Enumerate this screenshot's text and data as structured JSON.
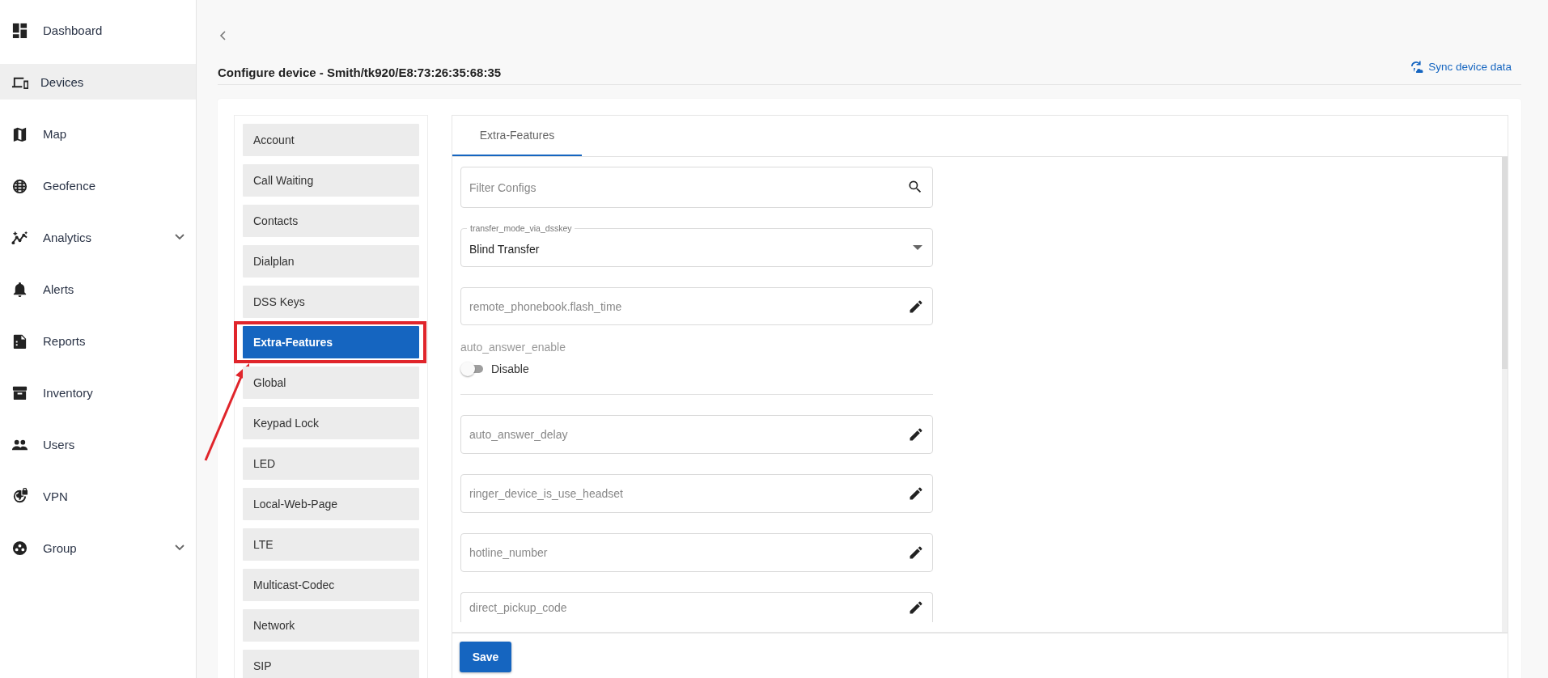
{
  "sidebar": {
    "items": [
      {
        "label": "Dashboard",
        "kind": "dashboard",
        "selected": false,
        "has_submenu": false
      },
      {
        "label": "Devices",
        "kind": "devices",
        "selected": true,
        "has_submenu": false
      },
      {
        "label": "Map",
        "kind": "map",
        "selected": false,
        "has_submenu": false
      },
      {
        "label": "Geofence",
        "kind": "geofence",
        "selected": false,
        "has_submenu": false
      },
      {
        "label": "Analytics",
        "kind": "analytics",
        "selected": false,
        "has_submenu": true
      },
      {
        "label": "Alerts",
        "kind": "alerts",
        "selected": false,
        "has_submenu": false
      },
      {
        "label": "Reports",
        "kind": "reports",
        "selected": false,
        "has_submenu": false
      },
      {
        "label": "Inventory",
        "kind": "inventory",
        "selected": false,
        "has_submenu": false
      },
      {
        "label": "Users",
        "kind": "users",
        "selected": false,
        "has_submenu": false
      },
      {
        "label": "VPN",
        "kind": "vpn",
        "selected": false,
        "has_submenu": false
      },
      {
        "label": "Group",
        "kind": "group",
        "selected": false,
        "has_submenu": true
      }
    ]
  },
  "header": {
    "title": "Configure device - Smith/tk920/E8:73:26:35:68:35",
    "sync_button": "Sync device data"
  },
  "sections": [
    {
      "label": "Account",
      "selected": false,
      "highlighted": false
    },
    {
      "label": "Call Waiting",
      "selected": false,
      "highlighted": false
    },
    {
      "label": "Contacts",
      "selected": false,
      "highlighted": false
    },
    {
      "label": "Dialplan",
      "selected": false,
      "highlighted": false
    },
    {
      "label": "DSS Keys",
      "selected": false,
      "highlighted": false
    },
    {
      "label": "Extra-Features",
      "selected": true,
      "highlighted": true
    },
    {
      "label": "Global",
      "selected": false,
      "highlighted": false
    },
    {
      "label": "Keypad Lock",
      "selected": false,
      "highlighted": false
    },
    {
      "label": "LED",
      "selected": false,
      "highlighted": false
    },
    {
      "label": "Local-Web-Page",
      "selected": false,
      "highlighted": false
    },
    {
      "label": "LTE",
      "selected": false,
      "highlighted": false
    },
    {
      "label": "Multicast-Codec",
      "selected": false,
      "highlighted": false
    },
    {
      "label": "Network",
      "selected": false,
      "highlighted": false
    },
    {
      "label": "SIP",
      "selected": false,
      "highlighted": false
    }
  ],
  "tabs": [
    {
      "label": "Extra-Features",
      "selected": true
    }
  ],
  "filter": {
    "placeholder": "Filter Configs"
  },
  "fields": [
    {
      "kind": "select",
      "label": "transfer_mode_via_dsskey",
      "value": "Blind Transfer"
    },
    {
      "kind": "text",
      "label": "remote_phonebook.flash_time"
    },
    {
      "kind": "toggle",
      "label": "auto_answer_enable",
      "on": false,
      "state_label": "Disable"
    },
    {
      "kind": "divider"
    },
    {
      "kind": "text",
      "label": "auto_answer_delay"
    },
    {
      "kind": "text",
      "label": "ringer_device_is_use_headset"
    },
    {
      "kind": "text",
      "label": "hotline_number"
    },
    {
      "kind": "text",
      "label": "direct_pickup_code"
    }
  ],
  "save_button": "Save"
}
